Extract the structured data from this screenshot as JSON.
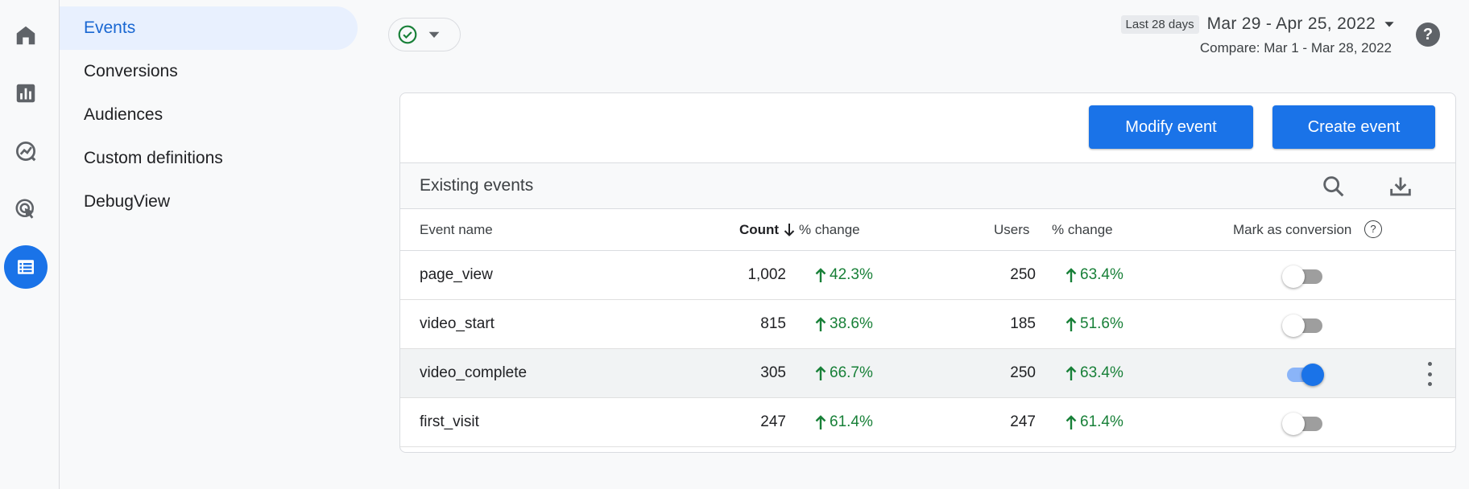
{
  "rail": {
    "items": [
      {
        "name": "home-icon"
      },
      {
        "name": "reports-icon"
      },
      {
        "name": "explore-icon"
      },
      {
        "name": "advertising-icon"
      },
      {
        "name": "configure-icon",
        "active": true
      }
    ],
    "active_color": "#1a73e8"
  },
  "subnav": {
    "items": [
      {
        "label": "Events",
        "active": true
      },
      {
        "label": "Conversions"
      },
      {
        "label": "Audiences"
      },
      {
        "label": "Custom definitions"
      },
      {
        "label": "DebugView"
      }
    ]
  },
  "header": {
    "date_badge": "Last 28 days",
    "date_range": "Mar 29 - Apr 25, 2022",
    "compare": "Compare: Mar 1 - Mar 28, 2022",
    "help": "?"
  },
  "card": {
    "modify_label": "Modify event",
    "create_label": "Create event",
    "title": "Existing events",
    "columns": {
      "event_name": "Event name",
      "count": "Count",
      "count_change": "% change",
      "users": "Users",
      "users_change": "% change",
      "mark_conversion": "Mark as conversion",
      "mark_help": "?"
    },
    "rows": [
      {
        "event_name": "page_view",
        "count": "1,002",
        "count_change": "42.3%",
        "users": "250",
        "users_change": "63.4%",
        "conversion": false
      },
      {
        "event_name": "video_start",
        "count": "815",
        "count_change": "38.6%",
        "users": "185",
        "users_change": "51.6%",
        "conversion": false
      },
      {
        "event_name": "video_complete",
        "count": "305",
        "count_change": "66.7%",
        "users": "250",
        "users_change": "63.4%",
        "conversion": true
      },
      {
        "event_name": "first_visit",
        "count": "247",
        "count_change": "61.4%",
        "users": "247",
        "users_change": "61.4%",
        "conversion": false
      }
    ]
  },
  "colors": {
    "accent": "#1a73e8",
    "positive": "#188038",
    "nav_active_bg": "#e8f0fe"
  }
}
